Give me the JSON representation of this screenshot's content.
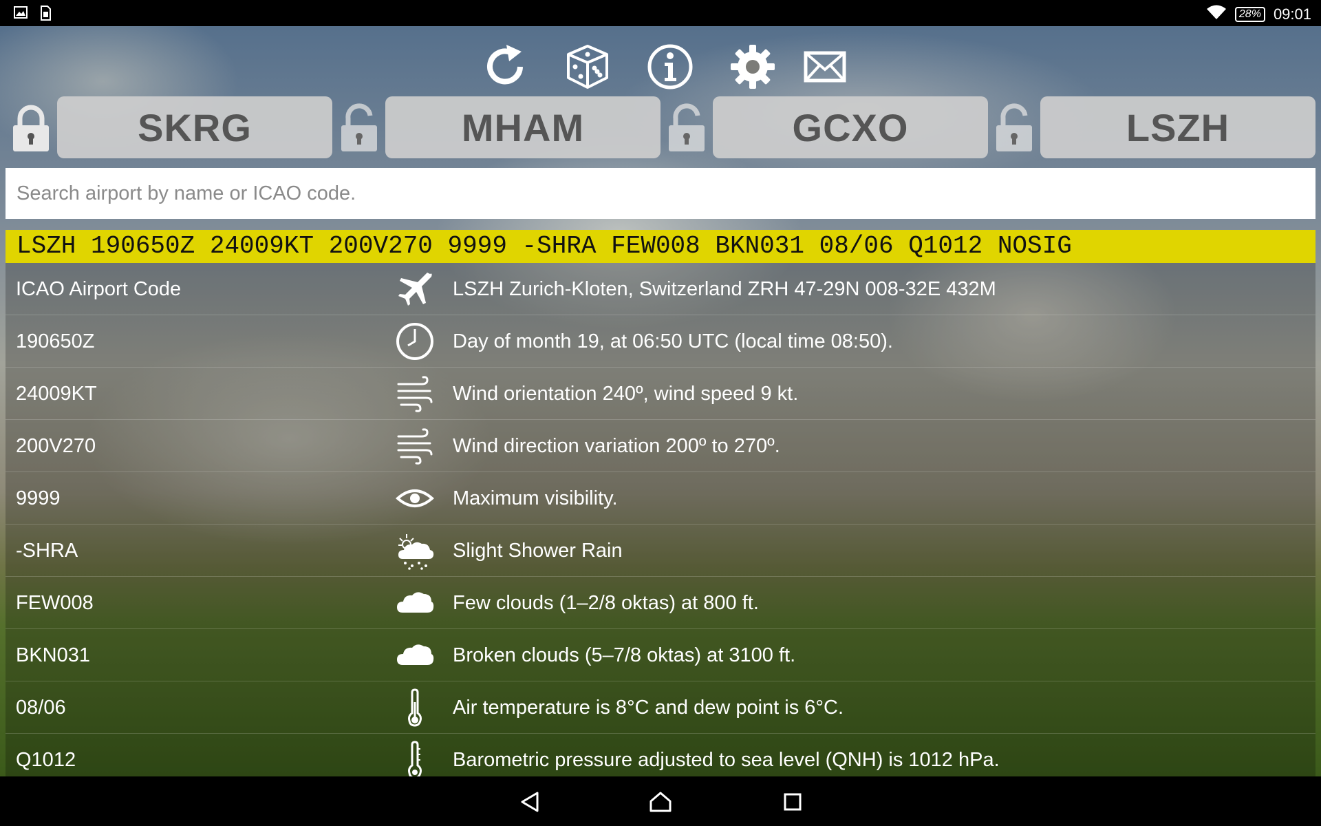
{
  "status_bar": {
    "left_icons": [
      "image-icon",
      "sim-icon"
    ],
    "battery": "28%",
    "time": "09:01"
  },
  "toolbar": {
    "icons": [
      "refresh-icon",
      "dice-icon",
      "info-icon",
      "settings-icon",
      "mail-icon"
    ]
  },
  "tabs": [
    {
      "code": "SKRG",
      "locked": true
    },
    {
      "code": "MHAM",
      "locked": false
    },
    {
      "code": "GCXO",
      "locked": false
    },
    {
      "code": "LSZH",
      "locked": false
    }
  ],
  "search": {
    "placeholder": "Search airport by name or ICAO code.",
    "value": ""
  },
  "metar_raw": "LSZH 190650Z 24009KT 200V270 9999 -SHRA FEW008 BKN031 08/06 Q1012 NOSIG",
  "rows": [
    {
      "code": "ICAO Airport Code",
      "icon": "airplane-icon",
      "desc": "LSZH Zurich-Kloten, Switzerland  ZRH 47-29N   008-32E   432M"
    },
    {
      "code": "190650Z",
      "icon": "clock-icon",
      "desc": "Day of month 19, at 06:50 UTC (local time 08:50)."
    },
    {
      "code": "24009KT",
      "icon": "wind-icon",
      "desc": "Wind orientation 240º, wind speed 9 kt."
    },
    {
      "code": "200V270",
      "icon": "wind-icon",
      "desc": "Wind direction variation 200º to 270º."
    },
    {
      "code": "9999",
      "icon": "eye-icon",
      "desc": "Maximum visibility."
    },
    {
      "code": "-SHRA",
      "icon": "shower-rain-icon",
      "desc": "Slight Shower Rain"
    },
    {
      "code": "FEW008",
      "icon": "cloud-icon",
      "desc": "Few clouds (1–2/8 oktas) at 800 ft."
    },
    {
      "code": "BKN031",
      "icon": "cloud-icon",
      "desc": "Broken clouds (5–7/8 oktas) at 3100 ft."
    },
    {
      "code": "08/06",
      "icon": "thermometer-icon",
      "desc": "Air temperature is 8°C and dew point is 6°C."
    },
    {
      "code": "Q1012",
      "icon": "barometer-icon",
      "desc": "Barometric pressure adjusted to sea level (QNH) is 1012 hPa."
    }
  ],
  "nav": [
    "back-icon",
    "home-icon",
    "recents-icon"
  ]
}
